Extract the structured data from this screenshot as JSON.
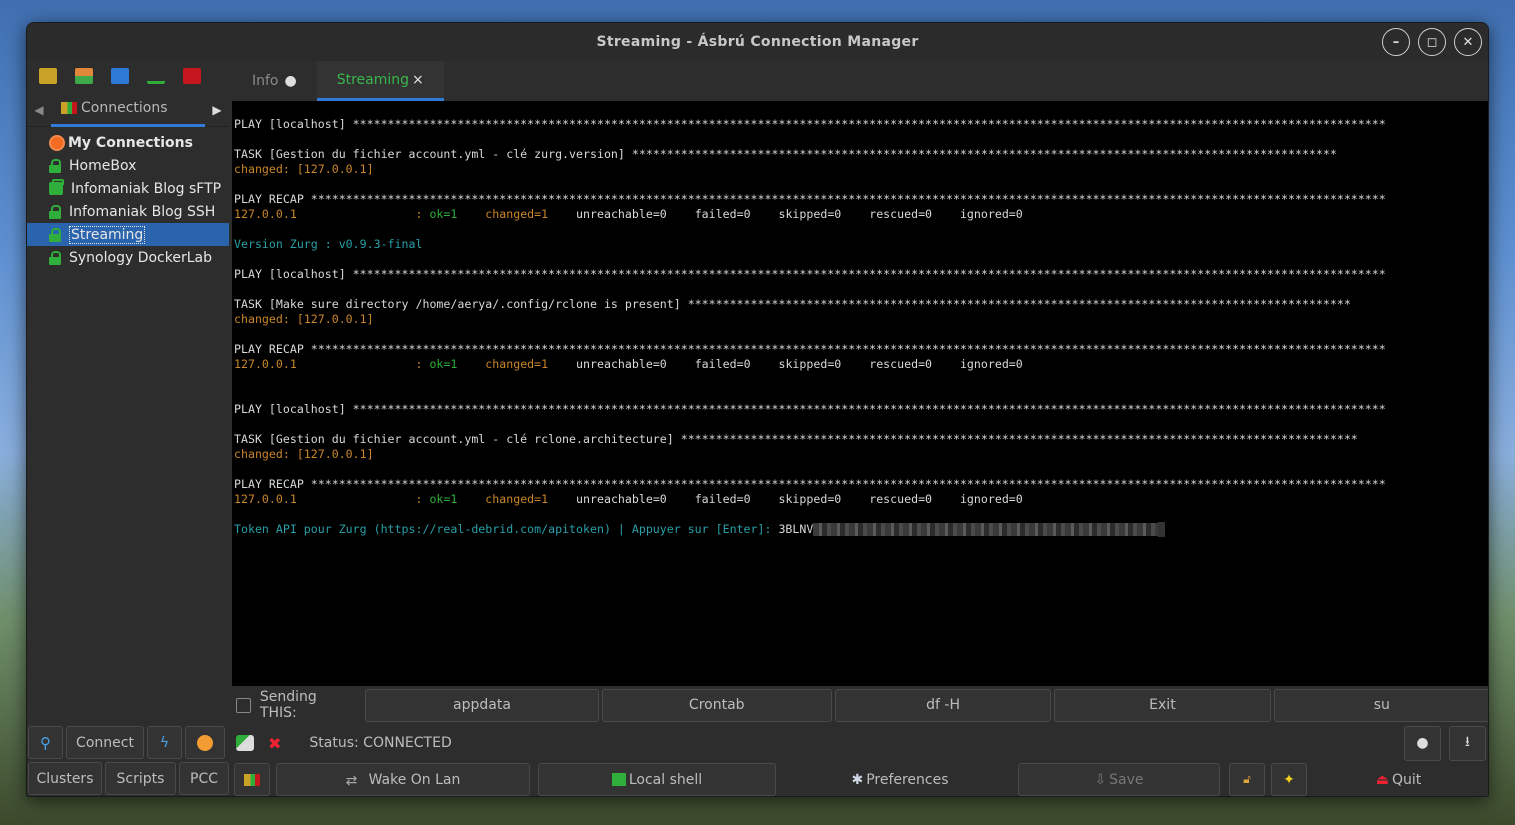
{
  "window": {
    "title": "Streaming  - Ásbrú Connection Manager"
  },
  "sidebar": {
    "tab_label": "Connections",
    "tree": [
      {
        "label": "My Connections",
        "type": "root"
      },
      {
        "label": "HomeBox",
        "type": "ssh"
      },
      {
        "label": "Infomaniak Blog sFTP",
        "type": "sftp"
      },
      {
        "label": "Infomaniak Blog SSH",
        "type": "ssh"
      },
      {
        "label": "Streaming",
        "type": "ssh",
        "selected": true
      },
      {
        "label": "Synology DockerLab",
        "type": "ssh"
      }
    ],
    "connect_label": "Connect",
    "clusters_label": "Clusters",
    "scripts_label": "Scripts",
    "pcc_label": "PCC"
  },
  "tabs": {
    "info": "Info",
    "streaming": "Streaming",
    "close": "×"
  },
  "terminal": {
    "lines": [
      {
        "text": "PLAY [localhost] ****************************************************************************************************************************************************",
        "color": "white"
      },
      {
        "text": "",
        "color": "white"
      },
      {
        "text": "TASK [Gestion du fichier account.yml - clé zurg.version] *****************************************************************************************************",
        "color": "white"
      },
      {
        "text": "changed: [127.0.0.1]",
        "color": "orange"
      },
      {
        "text": "",
        "color": "white"
      },
      {
        "text": "PLAY RECAP **********************************************************************************************************************************************************",
        "color": "white"
      },
      {
        "recap": true
      },
      {
        "text": "",
        "color": "white"
      },
      {
        "text": "Version Zurg : v0.9.3-final",
        "color": "cyan"
      },
      {
        "text": "",
        "color": "white"
      },
      {
        "text": "PLAY [localhost] ****************************************************************************************************************************************************",
        "color": "white"
      },
      {
        "text": "",
        "color": "white"
      },
      {
        "text": "TASK [Make sure directory /home/aerya/.config/rclone is present] ***********************************************************************************************",
        "color": "white"
      },
      {
        "text": "changed: [127.0.0.1]",
        "color": "orange"
      },
      {
        "text": "",
        "color": "white"
      },
      {
        "text": "PLAY RECAP **********************************************************************************************************************************************************",
        "color": "white"
      },
      {
        "recap": true
      },
      {
        "text": "",
        "color": "white"
      },
      {
        "text": "",
        "color": "white"
      },
      {
        "text": "PLAY [localhost] ****************************************************************************************************************************************************",
        "color": "white"
      },
      {
        "text": "",
        "color": "white"
      },
      {
        "text": "TASK [Gestion du fichier account.yml - clé rclone.architecture] *************************************************************************************************",
        "color": "white"
      },
      {
        "text": "changed: [127.0.0.1]",
        "color": "orange"
      },
      {
        "text": "",
        "color": "white"
      },
      {
        "text": "PLAY RECAP **********************************************************************************************************************************************************",
        "color": "white"
      },
      {
        "recap": true
      },
      {
        "text": "",
        "color": "white"
      },
      {
        "prompt": true
      }
    ],
    "recap": {
      "host": "127.0.0.1                 : ",
      "ok": "ok=1    ",
      "changed": "changed=1    ",
      "rest": "unreachable=0    failed=0    skipped=0    rescued=0    ignored=0"
    },
    "prompt": {
      "text": "Token API pour Zurg (https://real-debrid.com/apitoken) | Appuyer sur [Enter]: ",
      "input": "3BLNV"
    }
  },
  "send": {
    "label": "Sending THIS:",
    "buttons": [
      "appdata",
      "Crontab",
      "df -H",
      "Exit",
      "su"
    ]
  },
  "status": {
    "text": "Status: CONNECTED"
  },
  "bottom": {
    "wake_on_lan": "Wake On Lan",
    "local_shell": "Local shell",
    "preferences": "Preferences",
    "save": "Save",
    "quit": "Quit"
  }
}
